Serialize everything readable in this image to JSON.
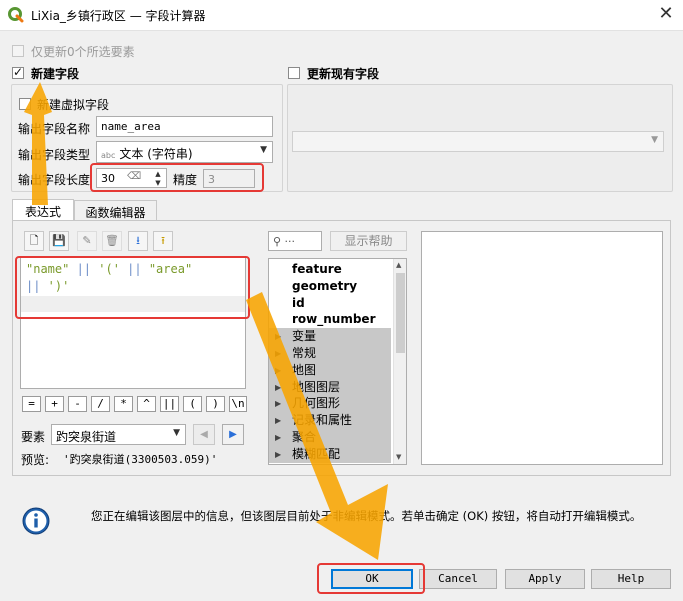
{
  "window": {
    "title": "LiXia_乡镇行政区 — 字段计算器",
    "close_glyph": "✕"
  },
  "options": {
    "only_selected_label": "仅更新0个所选要素",
    "new_field_label": "新建字段",
    "update_existing_label": "更新现有字段",
    "virtual_field_label": "新建虚拟字段",
    "output_name_label": "输出字段名称",
    "output_name_value": "name_area",
    "output_type_label": "输出字段类型",
    "output_type_badge": "abc",
    "output_type_value": "文本 (字符串)",
    "output_length_label": "输出字段长度",
    "output_length_value": "30",
    "precision_label": "精度",
    "precision_value": "3"
  },
  "tabs": [
    {
      "label": "表达式"
    },
    {
      "label": "函数编辑器"
    }
  ],
  "expression": {
    "line1": "\"name\" || '(' || \"area\"",
    "line2": "|| ')'",
    "operators": [
      "=",
      "+",
      "-",
      "/",
      "*",
      "^",
      "||",
      "(",
      ")",
      "\\n"
    ],
    "feature_label": "要素",
    "feature_value": "趵突泉街道",
    "preview_label": "预览:",
    "preview_value": "'趵突泉街道(3300503.059)'"
  },
  "functions": {
    "search_glyph": "⚲ ···",
    "show_help_label": "显示帮助",
    "items": [
      {
        "label": "feature",
        "kind": "bold"
      },
      {
        "label": "geometry",
        "kind": "bold"
      },
      {
        "label": "id",
        "kind": "bold"
      },
      {
        "label": "row_number",
        "kind": "bold"
      },
      {
        "label": "变量",
        "kind": "group"
      },
      {
        "label": "常规",
        "kind": "group"
      },
      {
        "label": "地图",
        "kind": "group"
      },
      {
        "label": "地图图层",
        "kind": "group"
      },
      {
        "label": "几何图形",
        "kind": "group"
      },
      {
        "label": "记录和属性",
        "kind": "group"
      },
      {
        "label": "聚合",
        "kind": "group"
      },
      {
        "label": "模糊匹配",
        "kind": "group"
      }
    ]
  },
  "info": {
    "message": "您正在编辑该图层中的信息，但该图层目前处于非编辑模式。若单击确定 (OK) 按钮，将自动打开编辑模式。"
  },
  "buttons": {
    "ok": "OK",
    "cancel": "Cancel",
    "apply": "Apply",
    "help": "Help"
  },
  "colors": {
    "accent": "#0078d7",
    "highlight_red": "#e53935",
    "arrow_orange": "#f7a400",
    "qgis_green": "#589632"
  }
}
